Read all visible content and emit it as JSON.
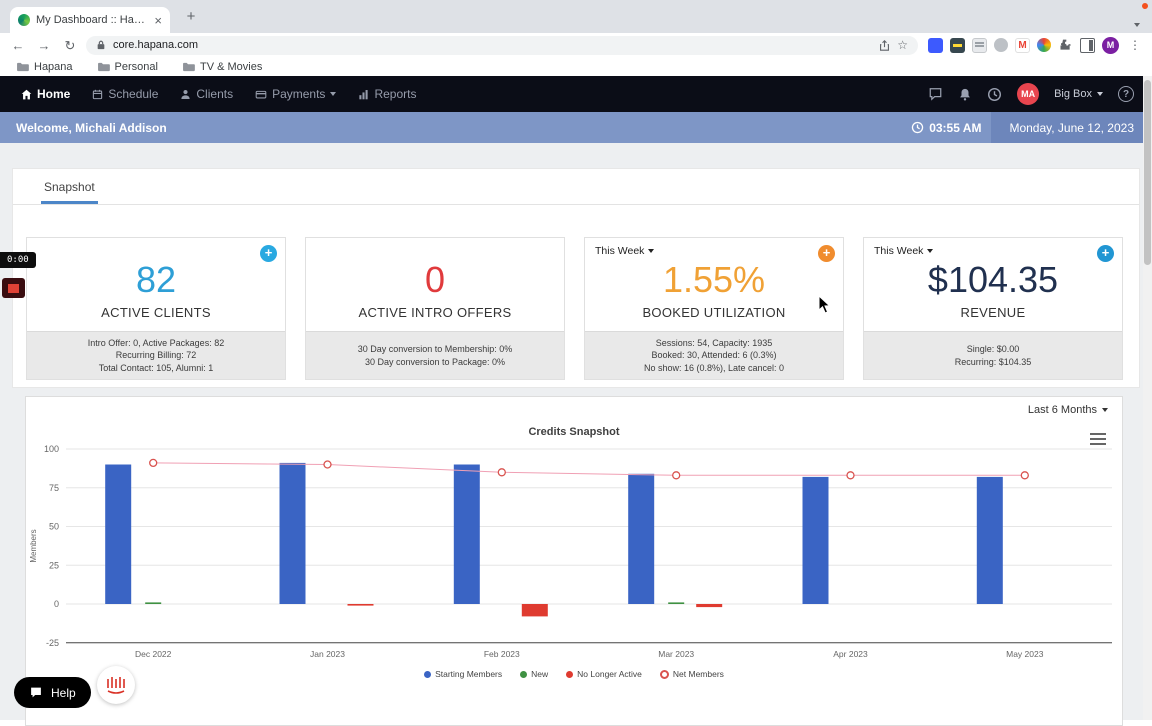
{
  "icons": {
    "close": "×",
    "plus": "+",
    "back": "←",
    "forward": "→",
    "reload": "↻",
    "star": "☆",
    "kebab": "⋮",
    "gmail_m": "M",
    "help_q": "?"
  },
  "colors": {
    "active_clients": "#2e9fd6",
    "intro_offers": "#e03a3c",
    "utilization": "#f0a135",
    "revenue": "#20304f",
    "welcome_bar": "#7e96c6",
    "navbar": "#0b0d17",
    "tab_underline": "#4c86c8"
  },
  "browser": {
    "tab": {
      "title": "My Dashboard :: Hapana | Tak"
    },
    "url": "core.hapana.com",
    "avatar_letter": "M",
    "bookmarks": [
      {
        "label": "Hapana"
      },
      {
        "label": "Personal"
      },
      {
        "label": "TV & Movies"
      }
    ]
  },
  "navbar": {
    "items": [
      {
        "label": "Home"
      },
      {
        "label": "Schedule"
      },
      {
        "label": "Clients"
      },
      {
        "label": "Payments"
      },
      {
        "label": "Reports"
      }
    ],
    "account_initials": "MA",
    "account_name": "Big Box"
  },
  "welcome": {
    "greeting": "Welcome, Michali Addison",
    "time": "03:55 AM",
    "date": "Monday, June 12, 2023"
  },
  "snapshot_tab": "Snapshot",
  "stat_cards": [
    {
      "value": "82",
      "value_color": "#2e9fd6",
      "label": "ACTIVE CLIENTS",
      "plus_color": "#29a9e1",
      "footer_lines": [
        "Intro Offer: 0, Active Packages: 82",
        "Recurring Billing: 72",
        "Total Contact: 105, Alumni: 1"
      ]
    },
    {
      "value": "0",
      "value_color": "#e03a3c",
      "label": "ACTIVE INTRO OFFERS",
      "footer_lines": [
        "30 Day conversion to Membership: 0%",
        "30 Day conversion to Package: 0%"
      ]
    },
    {
      "dropdown": "This Week",
      "value": "1.55%",
      "value_color": "#f0a135",
      "label": "BOOKED UTILIZATION",
      "plus_color": "#f08c2e",
      "footer_lines": [
        "Sessions: 54, Capacity: 1935",
        "Booked: 30, Attended: 6 (0.3%)",
        "No show: 16 (0.8%), Late cancel: 0"
      ]
    },
    {
      "dropdown": "This Week",
      "value": "$104.35",
      "value_color": "#20304f",
      "label": "REVENUE",
      "plus_color": "#2196d3",
      "footer_lines": [
        "Single: $0.00",
        "Recurring: $104.35"
      ]
    }
  ],
  "chart": {
    "range": "Last 6 Months",
    "title": "Credits Snapshot"
  },
  "chart_data": {
    "type": "bar+line",
    "title": "Credits Snapshot",
    "categories": [
      "Dec 2022",
      "Jan 2023",
      "Feb 2023",
      "Mar 2023",
      "Apr 2023",
      "May 2023"
    ],
    "series": [
      {
        "name": "Starting Members",
        "type": "column",
        "color": "#3a64c4",
        "values": [
          90,
          91,
          90,
          84,
          82,
          82
        ]
      },
      {
        "name": "New",
        "type": "column",
        "color": "#3f9142",
        "values": [
          1,
          0,
          0,
          1,
          0,
          0
        ]
      },
      {
        "name": "No Longer Active",
        "type": "column",
        "color": "#df3b30",
        "values": [
          0,
          -1,
          -8,
          -2,
          0,
          0
        ]
      },
      {
        "name": "Net Members",
        "type": "line",
        "color": "#f0a0b4",
        "marker_color": "#d9534f",
        "values": [
          91,
          90,
          85,
          83,
          83,
          83
        ]
      }
    ],
    "xlabel": "",
    "ylabel": "Members",
    "ylim": [
      -25,
      100
    ],
    "yticks": [
      -25,
      0,
      25,
      50,
      75,
      100
    ],
    "grid": true,
    "legend_position": "bottom"
  },
  "overlays": {
    "timer": "0:00",
    "help_label": "Help"
  }
}
